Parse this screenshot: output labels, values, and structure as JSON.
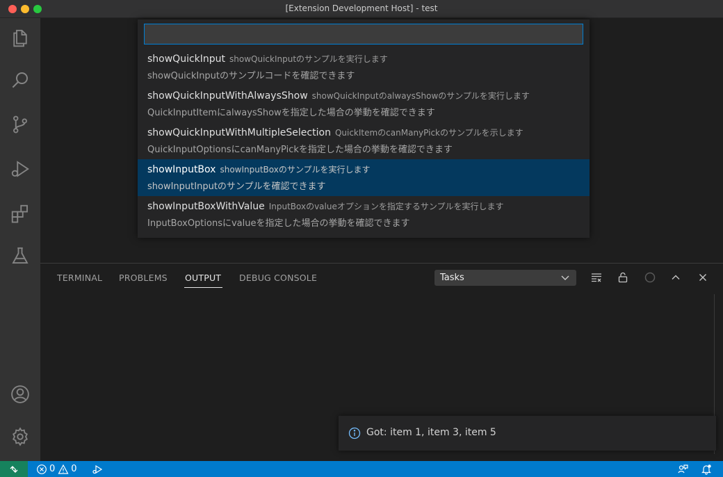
{
  "window": {
    "title": "[Extension Development Host] - test"
  },
  "quick_pick": {
    "input_value": "",
    "items": [
      {
        "label": "showQuickInput",
        "description": "showQuickInputのサンプルを実行します",
        "detail": "showQuickInputのサンプルコードを確認できます"
      },
      {
        "label": "showQuickInputWithAlwaysShow",
        "description": "showQuickInputのalwaysShowのサンプルを実行します",
        "detail": "QuickInputItemにalwaysShowを指定した場合の挙動を確認できます"
      },
      {
        "label": "showQuickInputWithMultipleSelection",
        "description": "QuickItemのcanManyPickのサンプルを示します",
        "detail": "QuickInputOptionsにcanManyPickを指定した場合の挙動を確認できます"
      },
      {
        "label": "showInputBox",
        "description": "showInputBoxのサンプルを実行します",
        "detail": "showInputInputのサンプルを確認できます"
      },
      {
        "label": "showInputBoxWithValue",
        "description": "InputBoxのvalueオプションを指定するサンプルを実行します",
        "detail": "InputBoxOptionsにvalueを指定した場合の挙動を確認できます"
      }
    ],
    "selected_index": 3
  },
  "panel": {
    "tabs": [
      {
        "label": "TERMINAL"
      },
      {
        "label": "PROBLEMS"
      },
      {
        "label": "OUTPUT"
      },
      {
        "label": "DEBUG CONSOLE"
      }
    ],
    "active_tab": "OUTPUT",
    "output_channel": "Tasks"
  },
  "notification": {
    "message": "Got: item 1, item 3, item 5"
  },
  "statusbar": {
    "errors": "0",
    "warnings": "0"
  },
  "colors": {
    "accent": "#007acc",
    "remote": "#16825d",
    "selection": "#04395e",
    "focus_border": "#007fd4"
  },
  "icons": {
    "activity": [
      "explorer-icon",
      "search-icon",
      "source-control-icon",
      "run-debug-icon",
      "extensions-icon",
      "testing-icon",
      "account-icon",
      "manage-gear-icon"
    ],
    "panel": [
      "clear-output-icon",
      "lock-icon",
      "circle-icon",
      "chevron-up-icon",
      "close-icon"
    ],
    "status": [
      "remote-icon",
      "error-icon",
      "warning-icon",
      "debug-run-icon",
      "feedback-icon",
      "bell-icon"
    ]
  }
}
